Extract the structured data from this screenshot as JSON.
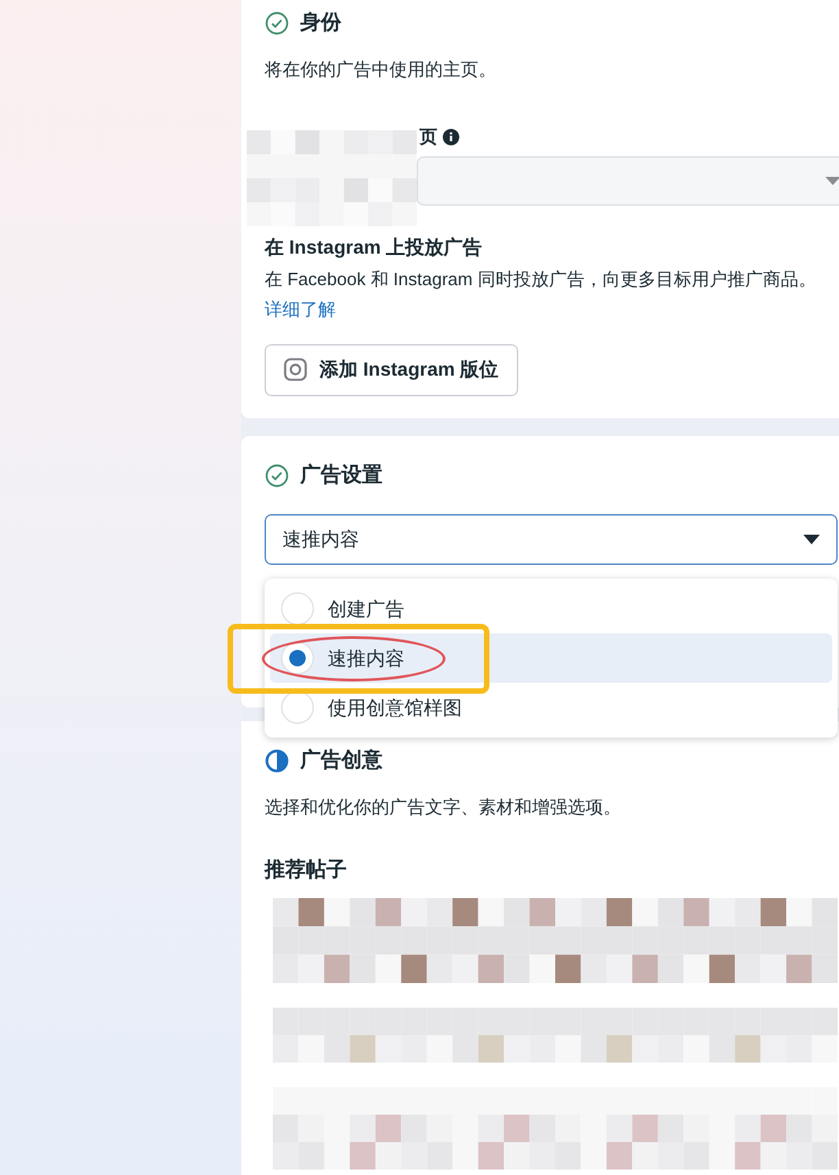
{
  "identity": {
    "title": "身份",
    "complete": true,
    "description": "将在你的广告中使用的主页。",
    "page_label": "页",
    "instagram": {
      "heading": "在 Instagram 上投放广告",
      "text": "在 Facebook 和 Instagram 同时投放广告，向更多目标用户推广商品。",
      "link": "详细了解",
      "button": "添加 Instagram 版位"
    }
  },
  "ad_setup": {
    "title": "广告设置",
    "complete": true,
    "select_value": "速推内容",
    "expanded": true,
    "options": [
      {
        "label": "创建广告",
        "selected": false
      },
      {
        "label": "速推内容",
        "selected": true
      },
      {
        "label": "使用创意馆样图",
        "selected": false
      }
    ]
  },
  "creative": {
    "title": "广告创意",
    "complete": false,
    "description": "选择和优化你的广告文字、素材和增强选项。",
    "posts_heading": "推荐帖子"
  }
}
